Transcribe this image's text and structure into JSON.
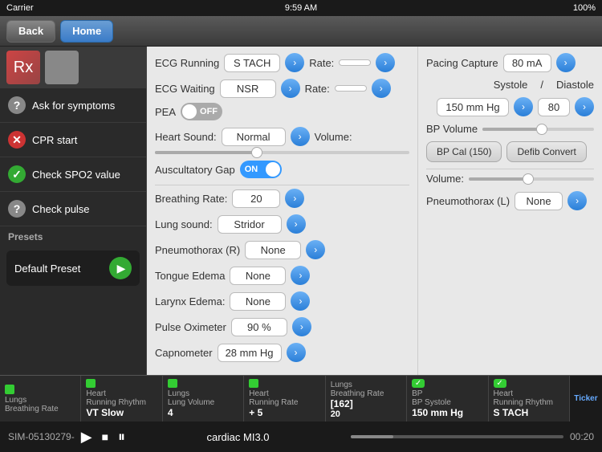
{
  "statusBar": {
    "carrier": "Carrier",
    "time": "9:59 AM",
    "battery": "100%"
  },
  "navBar": {
    "backLabel": "Back",
    "homeLabel": "Home"
  },
  "sidebar": {
    "menuItems": [
      {
        "id": "ask-symptoms",
        "icon": "?",
        "iconType": "question",
        "label": "Ask for symptoms"
      },
      {
        "id": "cpr-start",
        "icon": "✕",
        "iconType": "x",
        "label": "CPR start"
      },
      {
        "id": "check-spo2",
        "icon": "✓",
        "iconType": "check",
        "label": "Check SPO2 value"
      },
      {
        "id": "check-pulse",
        "icon": "?",
        "iconType": "question2",
        "label": "Check pulse"
      }
    ],
    "presetsLabel": "Presets",
    "presetName": "Default Preset"
  },
  "ecg": {
    "runningLabel": "ECG Running",
    "runningValue": "S TACH",
    "rateLabel": "Rate:",
    "waitingLabel": "ECG Waiting",
    "waitingValue": "NSR",
    "heartSoundLabel": "Heart Sound:",
    "heartSoundValue": "Normal",
    "volumeLabel": "Volume:",
    "auscultatoryLabel": "Auscultatory Gap",
    "auscultatoryToggle": "ON"
  },
  "breathing": {
    "rateLabel": "Breathing Rate:",
    "rateValue": "20",
    "lungSoundLabel": "Lung sound:",
    "lungSoundValue": "Stridor",
    "pneumothoraxRLabel": "Pneumothorax (R)",
    "pneumothoraxRValue": "None",
    "tongueEdemaLabel": "Tongue Edema",
    "tongueEdemaValue": "None",
    "larynxEdemaLabel": "Larynx Edema:",
    "larynxEdemaValue": "None",
    "pulseOximeterLabel": "Pulse Oximeter",
    "pulseOximeterValue": "90 %",
    "capnometerLabel": "Capnometer",
    "capnometerValue": "28 mm Hg"
  },
  "rightPanel": {
    "pacingCaptureLabel": "Pacing Capture",
    "pacingCaptureValue": "80 mA",
    "peaLabel": "PEA",
    "peaToggle": "OFF",
    "systoleLabel": "Systole",
    "diastoleLabel": "Diastole",
    "systoleValue": "150 mm Hg",
    "diastoleValue": "80",
    "bpVolumeLabel": "BP Volume",
    "bpCalLabel": "BP Cal (150)",
    "defibConvertLabel": "Defib Convert",
    "volumeLabel": "Volume:",
    "pneumothoraxLLabel": "Pneumothorax (L)",
    "pneumothoraxLValue": "None"
  },
  "ticker": {
    "items": [
      {
        "indicator": "green",
        "topLabel": "Lungs",
        "midLabel": "Breathing Rate",
        "value": ""
      },
      {
        "indicator": "green",
        "topLabel": "Heart",
        "midLabel": "Running Rhythm",
        "value": "VT Slow"
      },
      {
        "indicator": "green",
        "topLabel": "Lungs",
        "midLabel": "Lung Volume",
        "value": "4"
      },
      {
        "indicator": "green",
        "topLabel": "Heart",
        "midLabel": "Running Rate",
        "value": "+ 5"
      },
      {
        "indicator": "green",
        "topLabel": "Lungs",
        "midLabel": "Breathing Rate",
        "value": "20",
        "extra": "[162]"
      },
      {
        "indicator": "check",
        "topLabel": "BP",
        "midLabel": "BP Systole",
        "value": "150 mm Hg"
      },
      {
        "indicator": "check",
        "topLabel": "Heart",
        "midLabel": "Running Rhythm",
        "value": "S TACH"
      }
    ]
  },
  "player": {
    "simId": "SIM-05130279-",
    "title": "cardiac MI3.0",
    "time": "00:20",
    "playIcon": "▶",
    "stopIcon": "■",
    "pauseIcon": "⏸"
  }
}
